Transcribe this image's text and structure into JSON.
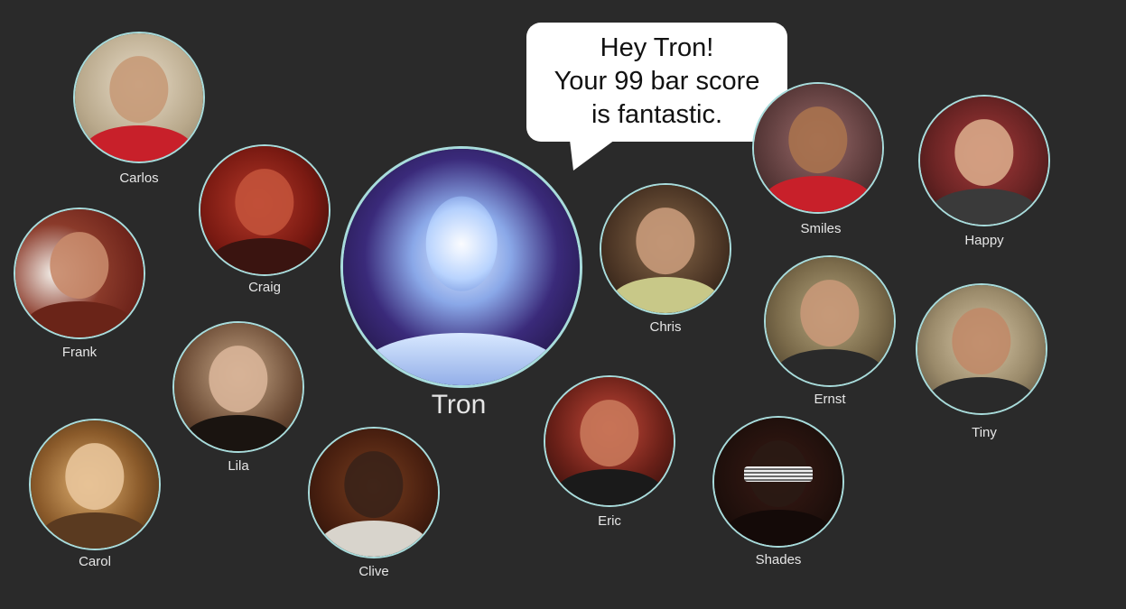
{
  "bubble": {
    "lines": [
      "Hey Tron!",
      "Your 99 bar score",
      "is fantastic."
    ]
  },
  "people": {
    "carlos": "Carlos",
    "craig": "Craig",
    "frank": "Frank",
    "lila": "Lila",
    "carol": "Carol",
    "clive": "Clive",
    "tron": "Tron",
    "chris": "Chris",
    "eric": "Eric",
    "smiles": "Smiles",
    "happy": "Happy",
    "ernst": "Ernst",
    "tiny": "Tiny",
    "shades": "Shades"
  },
  "colors": {
    "background": "#2a2a2a",
    "ring": "#a8dcdc",
    "label": "#e6e6e6",
    "bubble": "#ffffff"
  }
}
